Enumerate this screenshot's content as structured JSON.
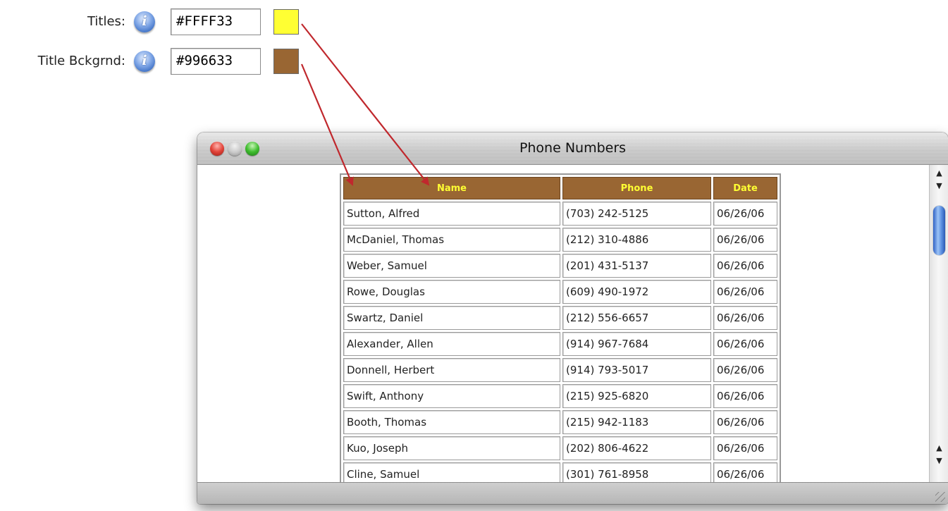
{
  "settings": {
    "titles": {
      "label": "Titles:",
      "value": "#FFFF33",
      "swatch_color": "#FFFF33"
    },
    "title_background": {
      "label": "Title Bckgrnd:",
      "value": "#996633",
      "swatch_color": "#996633"
    },
    "info_icon_glyph": "i"
  },
  "window": {
    "title": "Phone Numbers"
  },
  "table": {
    "headers": [
      "Name",
      "Phone",
      "Date"
    ],
    "header_text_color": "#FFFF33",
    "header_background": "#996633",
    "rows": [
      [
        "Sutton, Alfred",
        "(703) 242-5125",
        "06/26/06"
      ],
      [
        "McDaniel, Thomas",
        "(212) 310-4886",
        "06/26/06"
      ],
      [
        "Weber, Samuel",
        "(201) 431-5137",
        "06/26/06"
      ],
      [
        "Rowe, Douglas",
        "(609) 490-1972",
        "06/26/06"
      ],
      [
        "Swartz, Daniel",
        "(212) 556-6657",
        "06/26/06"
      ],
      [
        "Alexander, Allen",
        "(914) 967-7684",
        "06/26/06"
      ],
      [
        "Donnell, Herbert",
        "(914) 793-5017",
        "06/26/06"
      ],
      [
        "Swift, Anthony",
        "(215) 925-6820",
        "06/26/06"
      ],
      [
        "Booth, Thomas",
        "(215) 942-1183",
        "06/26/06"
      ],
      [
        "Kuo, Joseph",
        "(202) 806-4622",
        "06/26/06"
      ],
      [
        "Cline, Samuel",
        "(301) 761-8958",
        "06/26/06"
      ]
    ]
  },
  "icons": {
    "scroll_up": "▲",
    "scroll_down": "▼"
  },
  "colors": {
    "arrow": "#c0282d"
  }
}
